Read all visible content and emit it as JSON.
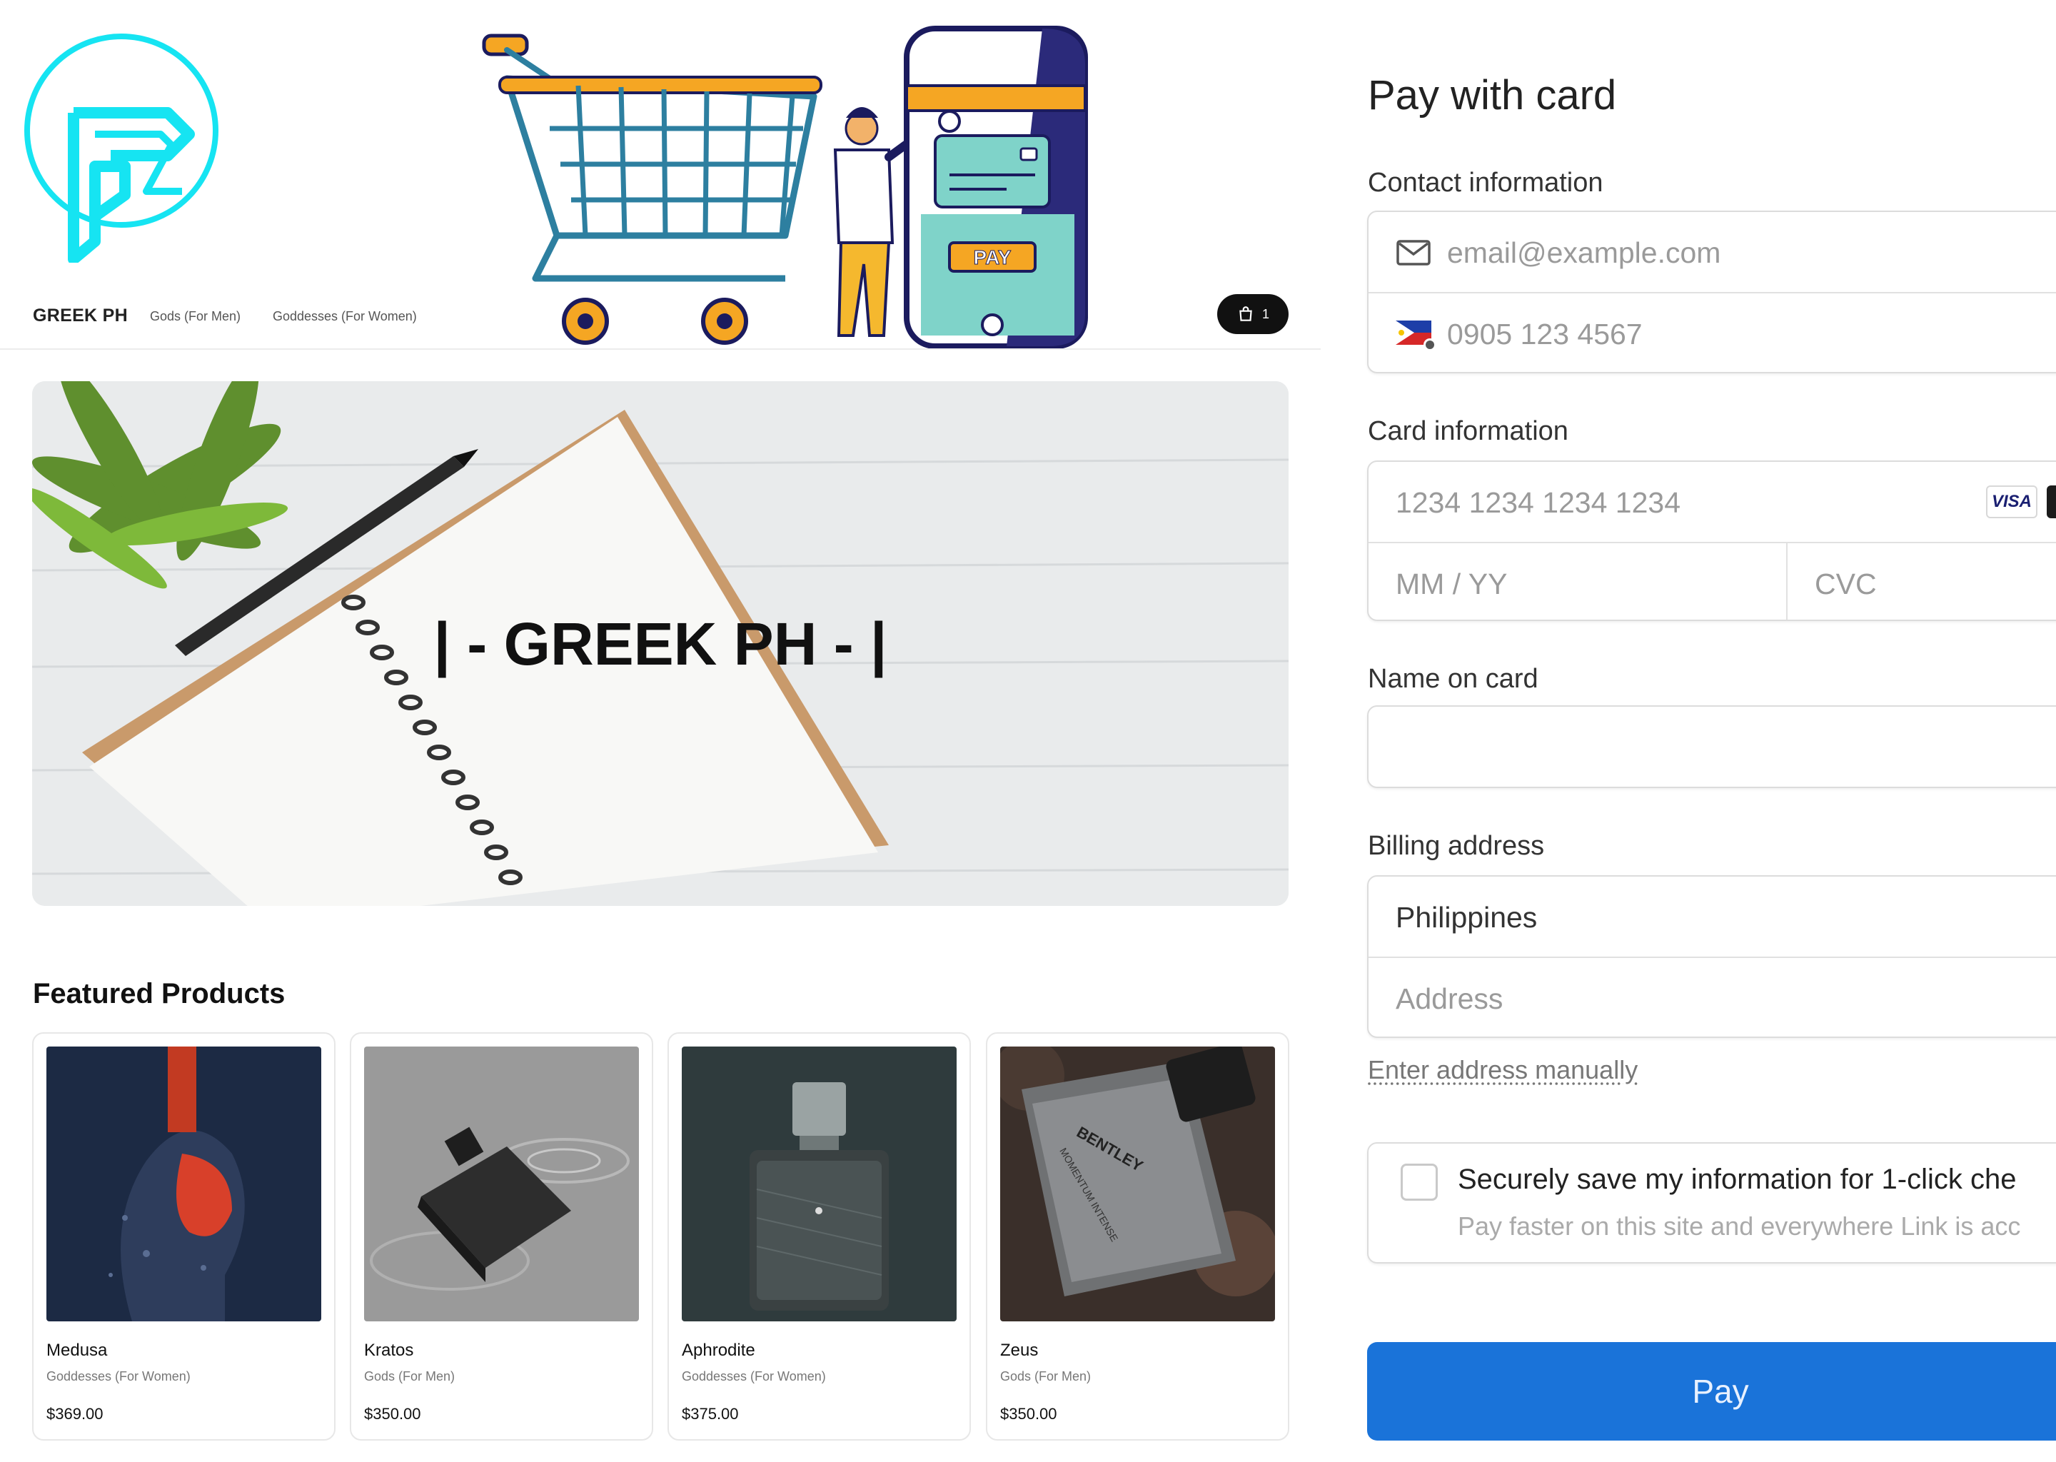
{
  "store": {
    "brand": "GREEK PH",
    "nav": [
      "Gods (For Men)",
      "Goddesses (For Women)"
    ],
    "cart_count": "1",
    "hero_title": "| - GREEK PH - |",
    "illustration_pay_label": "PAY",
    "featured_title": "Featured Products",
    "products": [
      {
        "name": "Medusa",
        "category": "Goddesses (For Women)",
        "price": "$369.00"
      },
      {
        "name": "Kratos",
        "category": "Gods (For Men)",
        "price": "$350.00"
      },
      {
        "name": "Aphrodite",
        "category": "Goddesses (For Women)",
        "price": "$375.00"
      },
      {
        "name": "Zeus",
        "category": "Gods (For Men)",
        "price": "$350.00"
      }
    ],
    "product_label_text": [
      "BENTLEY",
      "MOMENTUM INTENSE"
    ]
  },
  "checkout": {
    "title": "Pay with card",
    "contact_label": "Contact information",
    "email_placeholder": "email@example.com",
    "phone_placeholder": "0905 123 4567",
    "card_label": "Card information",
    "card_number_placeholder": "1234 1234 1234 1234",
    "card_brand_visa": "VISA",
    "expiry_placeholder": "MM / YY",
    "cvc_placeholder": "CVC",
    "name_label": "Name on card",
    "billing_label": "Billing address",
    "country": "Philippines",
    "address_placeholder": "Address",
    "enter_manually": "Enter address manually",
    "save_title": "Securely save my information for 1-click che",
    "save_subtitle": "Pay faster on this site and everywhere Link is acc",
    "pay_button": "Pay"
  },
  "colors": {
    "accent_blue": "#1a73d9",
    "logo_cyan": "#16e4f2",
    "cart_orange": "#f5a623",
    "hero_background": "#eceeef"
  },
  "icons": [
    "logo",
    "shopping-cart-illustration",
    "cart-icon",
    "mail-icon",
    "philippines-flag-icon",
    "visa-icon",
    "mastercard-icon",
    "checkbox"
  ]
}
